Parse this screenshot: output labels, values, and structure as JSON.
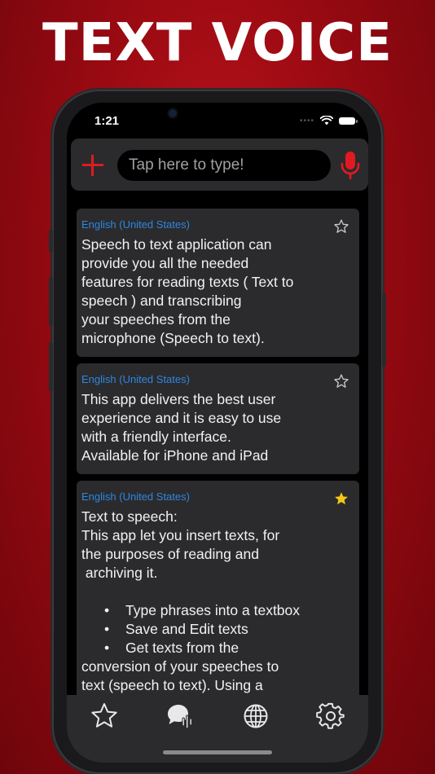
{
  "headline": "TEXT VOICE",
  "status": {
    "time": "1:21"
  },
  "topbar": {
    "placeholder": "Tap here to type!"
  },
  "cards": [
    {
      "lang": "English (United States)",
      "starred": false,
      "lines": [
        "Speech to text application can",
        "provide you all the needed",
        "features for reading texts ( Text to",
        "speech ) and transcribing",
        "your speeches from the",
        "microphone (Speech to text)."
      ]
    },
    {
      "lang": "English (United States)",
      "starred": false,
      "lines": [
        "This app delivers the best user",
        "experience and it is easy to use",
        "with a friendly interface.",
        "Available for iPhone and iPad"
      ]
    },
    {
      "lang": "English (United States)",
      "starred": true,
      "lines": [
        "Text to speech:",
        "This app let you insert texts, for",
        "the purposes of reading and",
        " archiving it."
      ],
      "bullets": [
        "Type phrases into a textbox",
        "Save and Edit texts",
        "Get texts from the"
      ],
      "tail": [
        "conversion of your speeches to",
        "text (speech to text). Using a"
      ]
    }
  ],
  "tabs": [
    {
      "name": "star-icon"
    },
    {
      "name": "speech-bubble-icon"
    },
    {
      "name": "globe-icon"
    },
    {
      "name": "gear-icon"
    }
  ],
  "colors": {
    "accent": "#e11a22",
    "lang": "#2f86e0",
    "star_filled": "#f5c518",
    "card": "#2b2b2d"
  }
}
